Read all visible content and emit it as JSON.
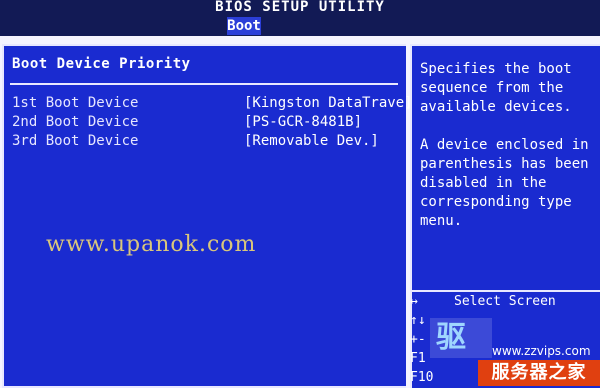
{
  "header": {
    "title": "BIOS SETUP UTILITY",
    "active_tab": "Boot"
  },
  "section": {
    "title": "Boot Device Priority"
  },
  "boot_devices": [
    {
      "label": "1st Boot Device",
      "value": "[Kingston DataTrave]"
    },
    {
      "label": "2nd Boot Device",
      "value": "[PS-GCR-8481B]"
    },
    {
      "label": "3rd Boot Device",
      "value": "[Removable Dev.]"
    }
  ],
  "help": {
    "paragraph1": "Specifies the boot sequence from the available devices.",
    "paragraph2": "A device enclosed in parenthesis has been disabled in the corresponding type menu."
  },
  "keys": [
    {
      "key": "↔",
      "desc": "Select Screen"
    },
    {
      "key": "↑↓",
      "desc": ""
    },
    {
      "key": "+-",
      "desc": ""
    },
    {
      "key": "F1",
      "desc": ""
    },
    {
      "key": "F10",
      "desc": ""
    }
  ],
  "watermarks": {
    "center": "www.upanok.com",
    "site": "www.zzvips.com",
    "brand": "服务器之家",
    "brand_tag": "驱动"
  }
}
